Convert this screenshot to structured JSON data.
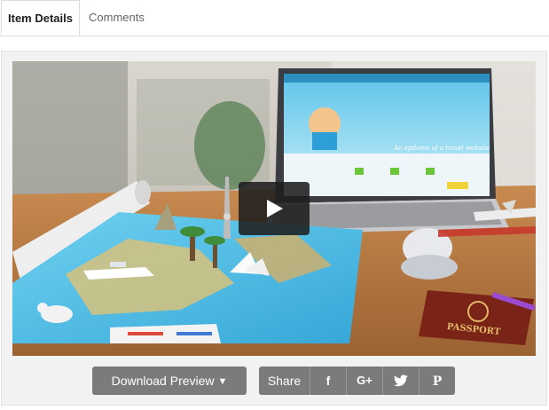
{
  "tabs": [
    {
      "label": "Item Details",
      "active": true
    },
    {
      "label": "Comments",
      "active": false
    }
  ],
  "video": {
    "laptop_banner_text": "An epitome of a travel website",
    "passport_text": "PASSPORT"
  },
  "actions": {
    "download_label": "Download Preview",
    "share_label": "Share",
    "social": [
      {
        "icon": "facebook-icon",
        "glyph": "f"
      },
      {
        "icon": "google-plus-icon",
        "glyph": "G+"
      },
      {
        "icon": "twitter-icon",
        "glyph": "🐦"
      },
      {
        "icon": "pinterest-icon",
        "glyph": "P"
      }
    ]
  },
  "colors": {
    "button_bg": "#7b7b7b",
    "play_bg": "#1e1e1e",
    "active_tab_text": "#222222",
    "inactive_tab_text": "#666666"
  }
}
